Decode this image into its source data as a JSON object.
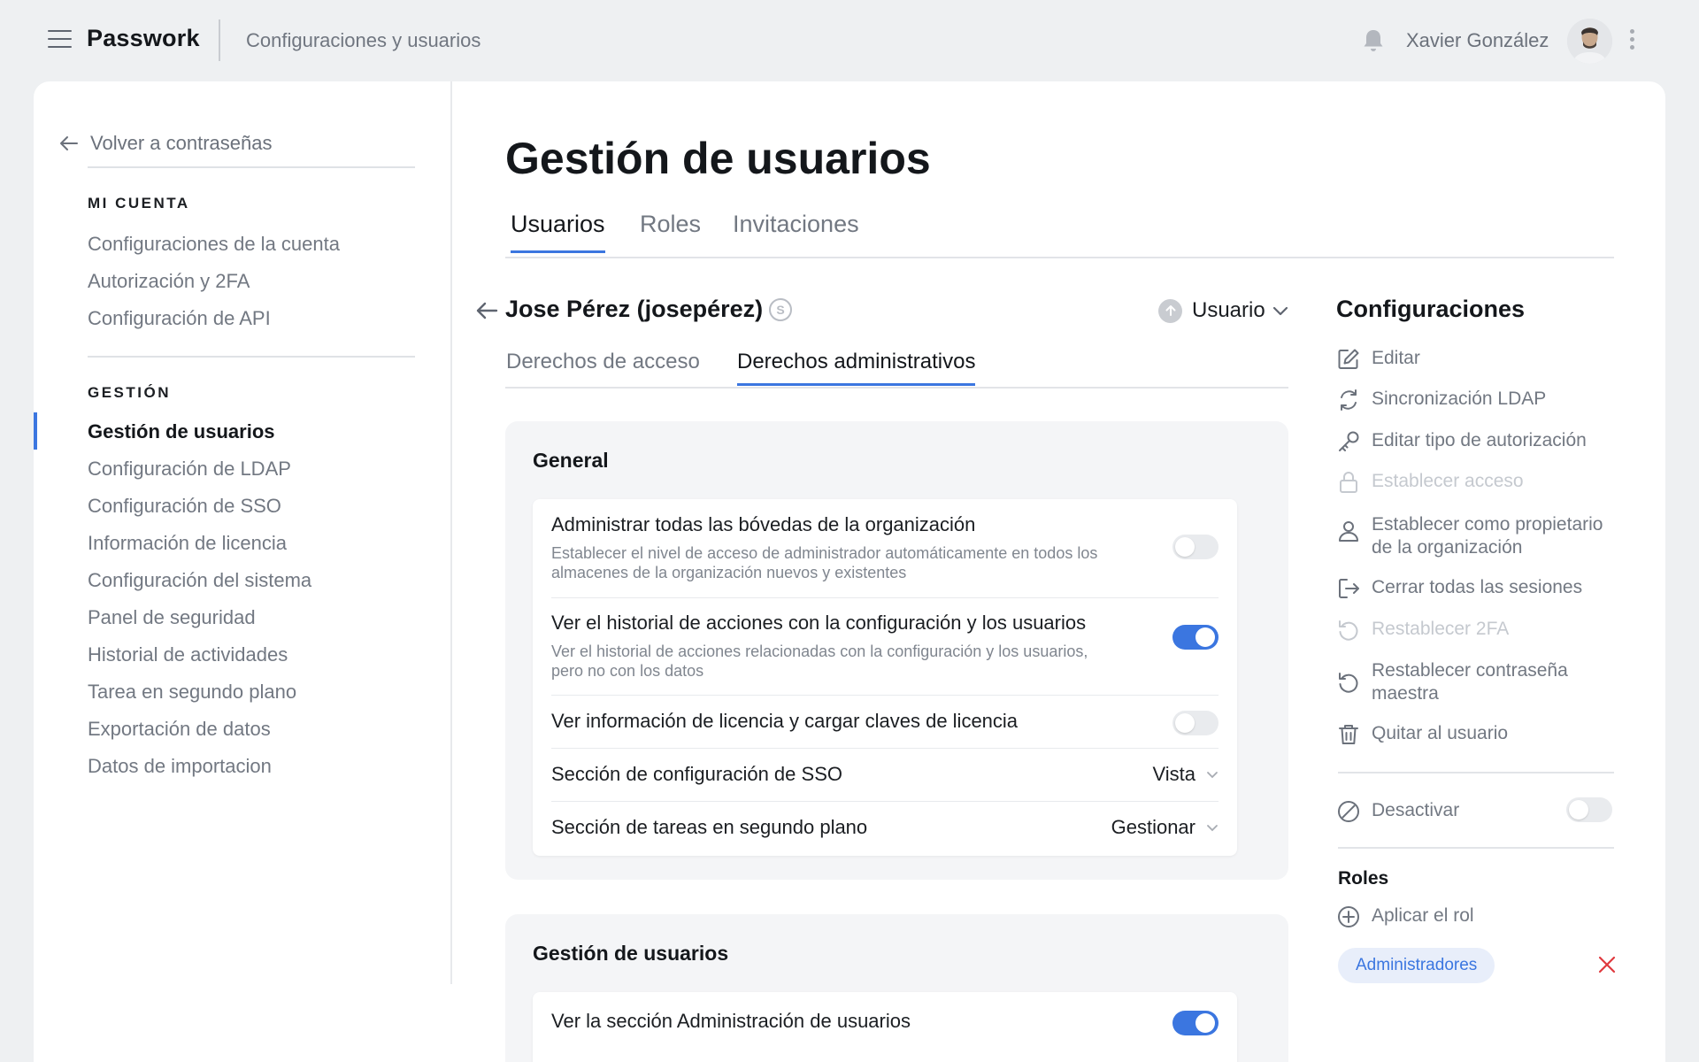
{
  "header": {
    "brand": "Passwork",
    "breadcrumb": "Configuraciones y usuarios",
    "user_name": "Xavier González"
  },
  "sidebar": {
    "back_label": "Volver a contraseñas",
    "section_account": "MI CUENTA",
    "account_items": [
      "Configuraciones de la cuenta",
      "Autorización y 2FA",
      "Configuración de API"
    ],
    "section_management": "GESTIÓN",
    "management_items": [
      "Gestión de usuarios",
      "Configuración de LDAP",
      "Configuración de SSO",
      "Información de licencia",
      "Configuración del sistema",
      "Panel de seguridad",
      "Historial de actividades",
      "Tarea en segundo plano",
      "Exportación de datos",
      "Datos de importacion"
    ],
    "active_item": "Gestión de usuarios"
  },
  "main": {
    "title": "Gestión de usuarios",
    "tabs": [
      "Usuarios",
      "Roles",
      "Invitaciones"
    ],
    "active_tab": "Usuarios",
    "user": {
      "name": "Jose Pérez (josepérez)",
      "badge": "S",
      "role": "Usuario"
    },
    "subtabs": [
      "Derechos de acceso",
      "Derechos administrativos"
    ],
    "active_subtab": "Derechos administrativos",
    "general": {
      "title": "General",
      "rows": [
        {
          "label": "Administrar todas las bóvedas de la organización",
          "description": "Establecer el nivel de acceso de administrador automáticamente en todos los almacenes de la organización nuevos y existentes",
          "toggle": false
        },
        {
          "label": "Ver el historial de acciones con la configuración y los usuarios",
          "description": "Ver el historial de acciones relacionadas con la configuración y los usuarios, pero no con los datos",
          "toggle": true
        },
        {
          "label": "Ver información de licencia y cargar claves de licencia",
          "toggle": false
        },
        {
          "label": "Sección de configuración de SSO",
          "select": "Vista"
        },
        {
          "label": "Sección de tareas en segundo plano",
          "select": "Gestionar"
        }
      ]
    },
    "user_management": {
      "title": "Gestión de usuarios",
      "rows": [
        {
          "label": "Ver la sección Administración de usuarios",
          "toggle": true
        }
      ]
    }
  },
  "config": {
    "title": "Configuraciones",
    "items": [
      {
        "label": "Editar",
        "icon": "edit-icon",
        "disabled": false
      },
      {
        "label": "Sincronización LDAP",
        "icon": "sync-icon",
        "disabled": false
      },
      {
        "label": "Editar tipo de autorización",
        "icon": "key-icon",
        "disabled": false
      },
      {
        "label": "Establecer acceso",
        "icon": "lock-icon",
        "disabled": true
      },
      {
        "label": "Establecer como propietario de la organización",
        "icon": "user-icon",
        "disabled": false
      },
      {
        "label": "Cerrar todas las sesiones",
        "icon": "logout-icon",
        "disabled": false
      },
      {
        "label": "Restablecer 2FA",
        "icon": "reset-icon",
        "disabled": true
      },
      {
        "label": "Restablecer contraseña maestra",
        "icon": "reset-icon",
        "disabled": false
      },
      {
        "label": "Quitar al usuario",
        "icon": "trash-icon",
        "disabled": false
      }
    ],
    "deactivate_label": "Desactivar",
    "deactivate_on": false,
    "roles_title": "Roles",
    "apply_role_label": "Aplicar el rol",
    "assigned_role": "Administradores"
  },
  "colors": {
    "accent": "#3b76e0",
    "danger": "#e0393e"
  }
}
